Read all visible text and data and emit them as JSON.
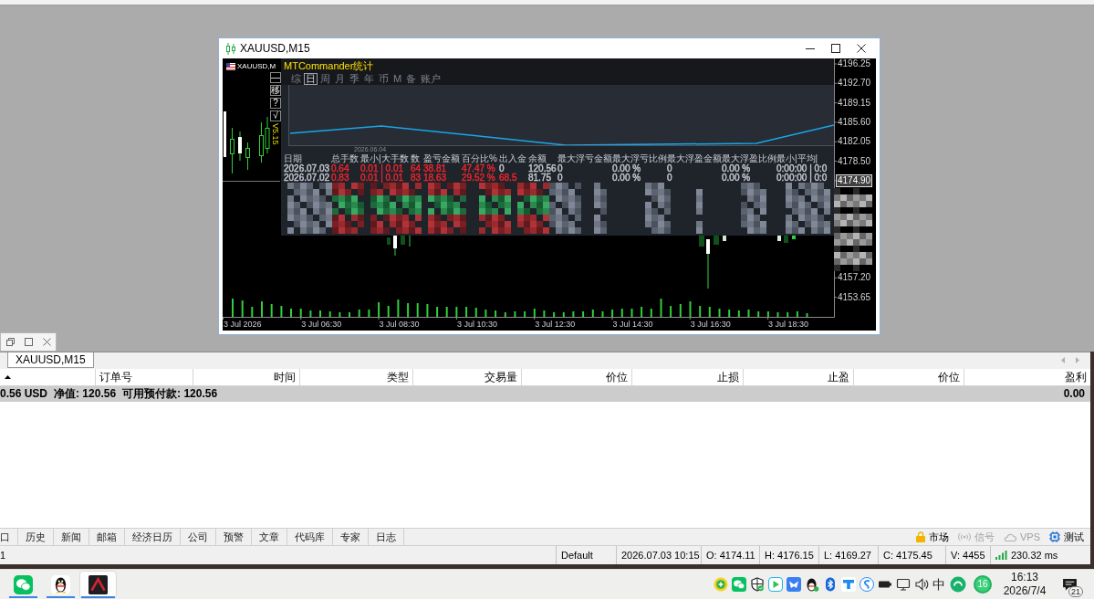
{
  "chart_window": {
    "title": "XAUUSD,M15",
    "symbol": "XAUUSD,M",
    "side_buttons": [
      "—",
      "移",
      "?",
      "√"
    ],
    "version": "V5.15",
    "price_axis": [
      {
        "label": "4196.25",
        "current": false
      },
      {
        "label": "4192.70",
        "current": false
      },
      {
        "label": "4189.15",
        "current": false
      },
      {
        "label": "4185.60",
        "current": false
      },
      {
        "label": "4182.05",
        "current": false
      },
      {
        "label": "4178.50",
        "current": false
      },
      {
        "label": "4174.90",
        "current": true
      },
      {
        "label": "4157.20",
        "current": false
      },
      {
        "label": "4153.65",
        "current": false
      }
    ],
    "time_axis": [
      "3 Jul 2026",
      "3 Jul 06:30",
      "3 Jul 08:30",
      "3 Jul 10:30",
      "3 Jul 12:30",
      "3 Jul 14:30",
      "3 Jul 16:30",
      "3 Jul 18:30"
    ]
  },
  "stats_panel": {
    "title": "MTCommander统计",
    "tabs": [
      {
        "label": "综",
        "selected": false
      },
      {
        "label": "日",
        "selected": true
      },
      {
        "label": "周",
        "selected": false
      },
      {
        "label": "月",
        "selected": false
      },
      {
        "label": "季",
        "selected": false
      },
      {
        "label": "年",
        "selected": false
      },
      {
        "label": "币",
        "selected": false
      },
      {
        "label": "M",
        "selected": false
      },
      {
        "label": "备",
        "selected": false
      },
      {
        "label": "账户",
        "selected": false
      }
    ],
    "graph_date": "2026.06.04",
    "columns": [
      "日期",
      "总手数",
      "最小|大手数",
      "数",
      "盈亏金额",
      "百分比%",
      "出入金",
      "余额",
      "最大浮亏金额",
      "最大浮亏比例",
      "最大浮盈金额",
      "最大浮盈比例",
      "最小|平均|"
    ],
    "rows": [
      {
        "cells": [
          {
            "text": "2026.07.03",
            "color": "#c3c7cf"
          },
          {
            "text": "0.64",
            "color": "#e8262e"
          },
          {
            "text": "0.01 | 0.01",
            "color": "#e8262e"
          },
          {
            "text": "64",
            "color": "#e8262e"
          },
          {
            "text": "38.81",
            "color": "#e8262e"
          },
          {
            "text": "47.47 %",
            "color": "#e8262e"
          },
          {
            "text": "0",
            "color": "#c3c7cf"
          },
          {
            "text": "120.56",
            "color": "#c3c7cf"
          },
          {
            "text": "0",
            "color": "#c3c7cf"
          },
          {
            "text": "0.00 %",
            "color": "#c3c7cf"
          },
          {
            "text": "0",
            "color": "#c3c7cf"
          },
          {
            "text": "0.00 %",
            "color": "#c3c7cf"
          },
          {
            "text": "0:00:00 | 0:0",
            "color": "#c3c7cf"
          }
        ]
      },
      {
        "cells": [
          {
            "text": "2026.07.02",
            "color": "#c3c7cf"
          },
          {
            "text": "0.83",
            "color": "#e8262e"
          },
          {
            "text": "0.01 | 0.01",
            "color": "#e8262e"
          },
          {
            "text": "83",
            "color": "#e8262e"
          },
          {
            "text": "18.63",
            "color": "#e8262e"
          },
          {
            "text": "29.52 %",
            "color": "#e8262e"
          },
          {
            "text": "68.5",
            "color": "#e8262e"
          },
          {
            "text": "81.75",
            "color": "#c3c7cf"
          },
          {
            "text": "0",
            "color": "#c3c7cf"
          },
          {
            "text": "0.00 %",
            "color": "#c3c7cf"
          },
          {
            "text": "0",
            "color": "#c3c7cf"
          },
          {
            "text": "0.00 %",
            "color": "#c3c7cf"
          },
          {
            "text": "0:00:00 | 0:0",
            "color": "#c3c7cf"
          }
        ]
      }
    ]
  },
  "terminal": {
    "tab": "XAUUSD,M15",
    "columns": [
      "订单号",
      "时间",
      "类型",
      "交易量",
      "价位",
      "止损",
      "止盈",
      "价位",
      "盈利"
    ],
    "summary": [
      "0.56 USD",
      "净值: 120.56",
      "可用预付款: 120.56"
    ],
    "total_profit": "0.00",
    "tabs": [
      "口",
      "历史",
      "新闻",
      "邮箱",
      "经济日历",
      "公司",
      "预警",
      "文章",
      "代码库",
      "专家",
      "日志"
    ],
    "services": [
      {
        "kind": "market",
        "label": "市场",
        "disabled": false
      },
      {
        "kind": "signals",
        "label": "信号",
        "disabled": true
      },
      {
        "kind": "vps",
        "label": "VPS",
        "disabled": true
      },
      {
        "kind": "tester",
        "label": "测试",
        "disabled": false
      }
    ]
  },
  "status_bar": {
    "fields": [
      "1",
      "Default",
      "2026.07.03 10:15",
      "O: 4174.11",
      "H: 4176.15",
      "L: 4169.27",
      "C: 4175.45",
      "V: 4455"
    ],
    "ping": "230.32 ms"
  },
  "taskbar": {
    "apps": [
      {
        "kind": "chat",
        "running": true,
        "active": false
      },
      {
        "kind": "penguin",
        "running": true,
        "active": false
      },
      {
        "kind": "logo",
        "running": true,
        "active": true
      }
    ],
    "ime": "中",
    "counter": "16",
    "time": "16:13",
    "date": "2026/7/4",
    "notifications": "21"
  }
}
